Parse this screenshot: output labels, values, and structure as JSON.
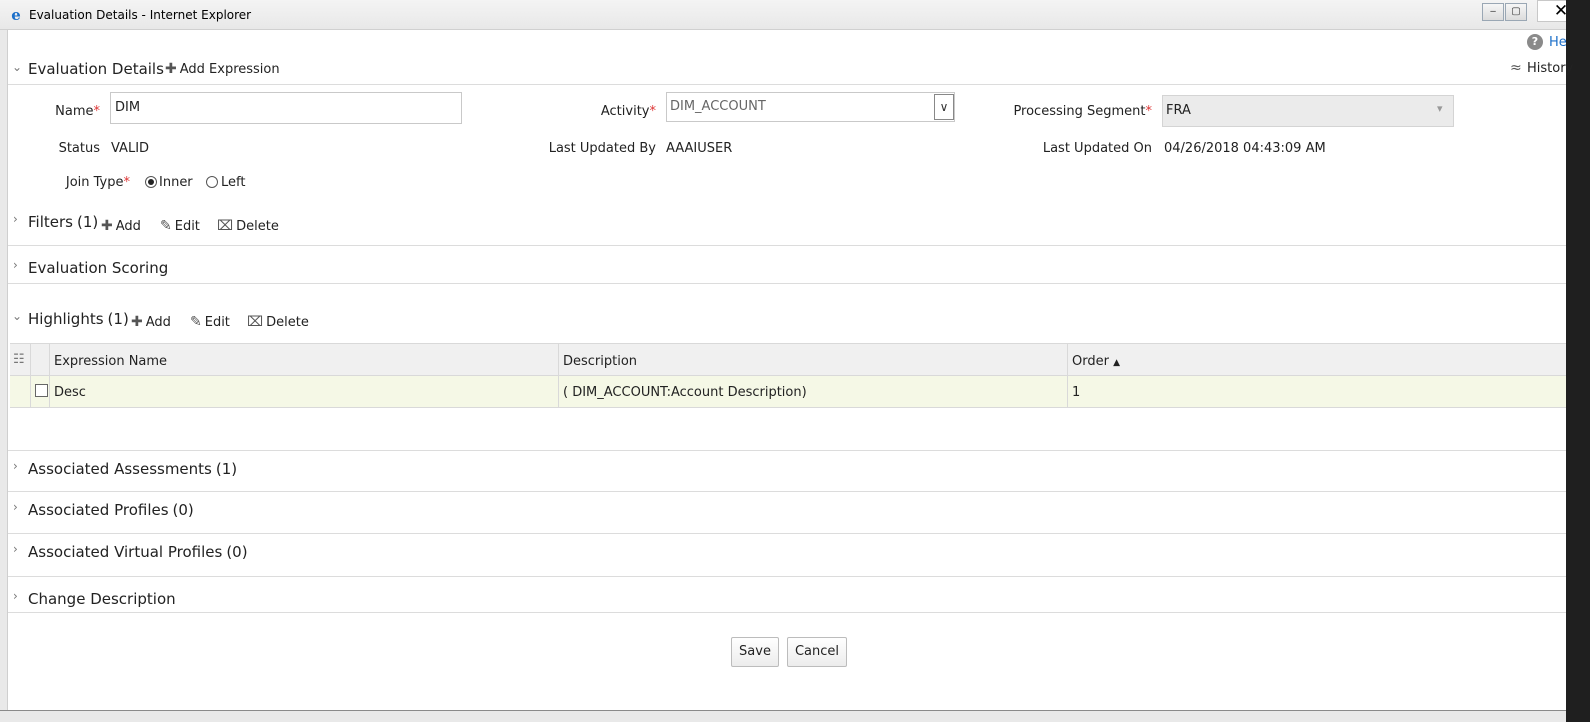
{
  "window": {
    "title": "Evaluation Details - Internet Explorer",
    "minimize_glyph": "‒",
    "restore_glyph": "▢",
    "close_glyph": "✕"
  },
  "top_links": {
    "help": "He",
    "history": "History"
  },
  "evaluation_details": {
    "title": "Evaluation Details",
    "add_expression": "Add Expression",
    "fields": {
      "name_label": "Name",
      "name_value": "DIM",
      "activity_label": "Activity",
      "activity_value": "DIM_ACCOUNT",
      "processing_segment_label": "Processing Segment",
      "processing_segment_value": "FRA",
      "status_label": "Status",
      "status_value": "VALID",
      "last_updated_by_label": "Last Updated By",
      "last_updated_by_value": "AAAIUSER",
      "last_updated_on_label": "Last Updated On",
      "last_updated_on_value": "04/26/2018 04:43:09 AM",
      "join_type_label": "Join Type",
      "join_inner": "Inner",
      "join_left": "Left",
      "join_selected": "Inner",
      "required_mark": "*"
    }
  },
  "filters": {
    "title": "Filters",
    "count": "(1)",
    "add": "Add",
    "edit": "Edit",
    "delete": "Delete"
  },
  "evaluation_scoring": {
    "title": "Evaluation Scoring"
  },
  "highlights": {
    "title": "Highlights",
    "count": "(1)",
    "add": "Add",
    "edit": "Edit",
    "delete": "Delete",
    "columns": [
      "Expression Name",
      "Description",
      "Order"
    ],
    "sort_indicator": "▲",
    "rows": [
      {
        "expression_name": "Desc",
        "description": "( DIM_ACCOUNT:Account Description)",
        "order": "1"
      }
    ]
  },
  "associated_assessments": {
    "title": "Associated Assessments",
    "count": "(1)"
  },
  "associated_profiles": {
    "title": "Associated Profiles",
    "count": "(0)"
  },
  "associated_virtual_profiles": {
    "title": "Associated Virtual Profiles",
    "count": "(0)"
  },
  "change_description": {
    "title": "Change Description"
  },
  "actions": {
    "save": "Save",
    "cancel": "Cancel"
  },
  "glyphs": {
    "chevron_down": "⌄",
    "chevron_right": "›",
    "plus": "✚",
    "edit": "✎",
    "trash": "⌧",
    "question": "?",
    "history": "≈",
    "tree": "☷",
    "select_arrow": "∨",
    "select_arrow_small": "▾",
    "ie": "e"
  },
  "colors": {
    "required": "#dd3333",
    "row_highlight": "#f5f8e6",
    "link_blue": "#1c6fc9"
  }
}
